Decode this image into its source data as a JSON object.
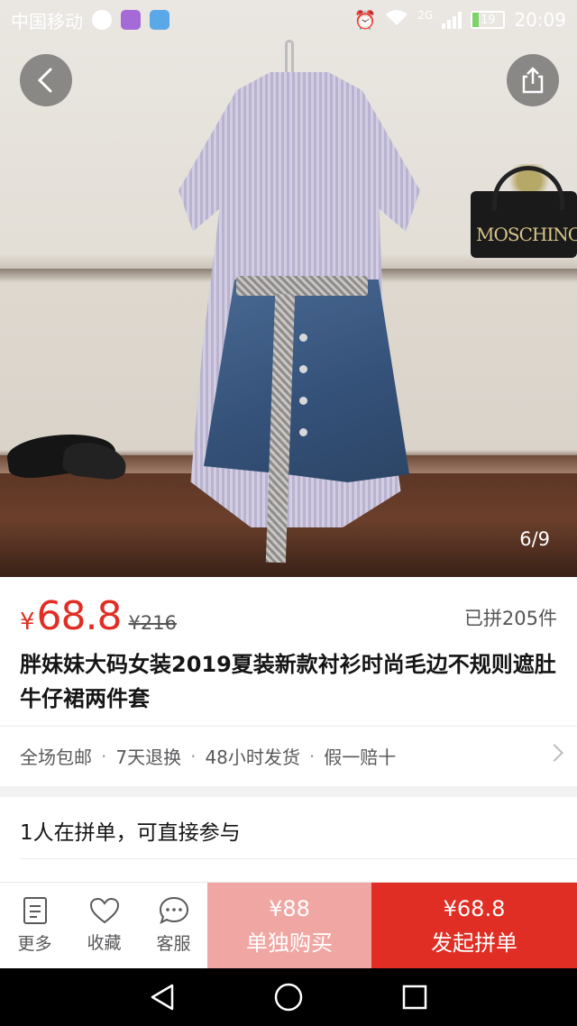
{
  "status_bar": {
    "carrier": "中国移动",
    "network": "2G",
    "battery": "19",
    "time": "20:09"
  },
  "gallery": {
    "pager": "6/9",
    "bag_logo": "MOSCHINO"
  },
  "product": {
    "currency": "¥",
    "price": "68.8",
    "original_price": "¥216",
    "sold": "已拼205件",
    "title": "胖妹妹大码女装2019夏装新款衬衫时尚毛边不规则遮肚牛仔裙两件套"
  },
  "services": [
    "全场包邮",
    "7天退换",
    "48小时发货",
    "假一赔十"
  ],
  "services_sep": "·",
  "group_buy": {
    "title": "1人在拼单，可直接参与"
  },
  "bottom_bar": {
    "more": "更多",
    "favorite": "收藏",
    "service": "客服",
    "solo_price": "¥88",
    "solo_label": "单独购买",
    "group_price": "¥68.8",
    "group_label": "发起拼单"
  },
  "colors": {
    "accent": "#e02e24",
    "solo_button": "#f0a7a3"
  }
}
